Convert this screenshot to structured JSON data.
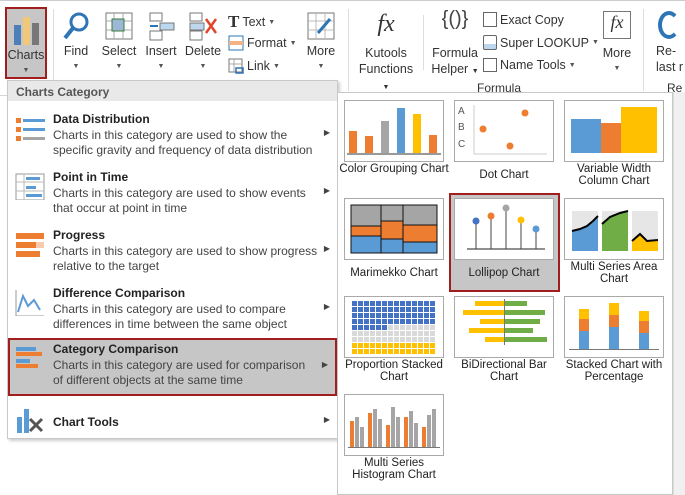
{
  "ribbon": {
    "charts": "Charts",
    "find": "Find",
    "select": "Select",
    "insert": "Insert",
    "delete": "Delete",
    "text": "Text",
    "format": "Format",
    "link": "Link",
    "more1": "More",
    "kutools1": "Kutools",
    "kutools2": "Functions",
    "formula1": "Formula",
    "formula2": "Helper",
    "exact_copy": "Exact Copy",
    "super_lookup": "Super LOOKUP",
    "name_tools": "Name Tools",
    "more2": "More",
    "re1": "Re-",
    "re2": "last r",
    "group_formula": "Formula",
    "group_re": "Re"
  },
  "menu": {
    "header": "Charts Category",
    "items": [
      {
        "title": "Data Distribution",
        "desc": "Charts in this category are used to show the specific gravity and frequency of data distribution"
      },
      {
        "title": "Point in Time",
        "desc": "Charts in this category are used to show events that occur at point in time"
      },
      {
        "title": "Progress",
        "desc": "Charts in this category are used to show progress relative to the target"
      },
      {
        "title": "Difference Comparison",
        "desc": "Charts in this category are used to compare differences in time between the same object"
      },
      {
        "title": "Category Comparison",
        "desc": "Charts in this category are used for comparison of different objects at the same time",
        "selected": true
      },
      {
        "title": "Chart Tools",
        "desc": ""
      }
    ]
  },
  "gallery": {
    "items": [
      {
        "label": "Color Grouping Chart"
      },
      {
        "label": "Dot Chart"
      },
      {
        "label": "Variable Width Column Chart"
      },
      {
        "label": "Marimekko Chart"
      },
      {
        "label": "Lollipop Chart",
        "selected": true
      },
      {
        "label": "Multi Series Area Chart"
      },
      {
        "label": "Proportion Stacked Chart"
      },
      {
        "label": "BiDirectional Bar Chart"
      },
      {
        "label": "Stacked Chart with Percentage"
      },
      {
        "label": "Multi Series Histogram Chart"
      }
    ],
    "dot_labels": [
      "A",
      "B",
      "C"
    ]
  },
  "colors": {
    "accent_border": "#a01e1e",
    "blue": "#5b9bd5",
    "orange": "#ed7d31",
    "gray": "#a5a5a5",
    "yellow": "#ffc000",
    "green": "#70ad47"
  }
}
